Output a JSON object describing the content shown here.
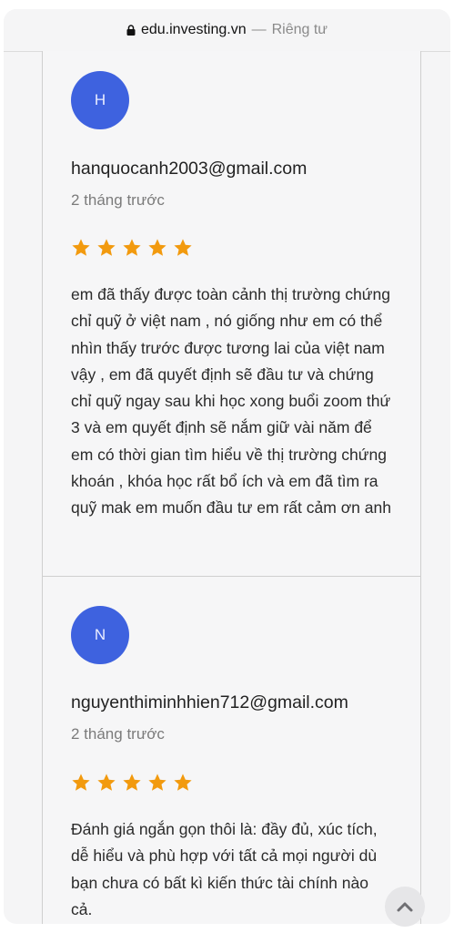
{
  "browser": {
    "domain": "edu.investing.vn",
    "separator": "—",
    "privacy_label": "Riêng tư"
  },
  "colors": {
    "avatar": "#3e62df",
    "star": "#f29a0e"
  },
  "reviews": [
    {
      "avatar_letter": "H",
      "email": "hanquocanh2003@gmail.com",
      "time": "2 tháng trước",
      "rating": 5,
      "text": "em đã thấy được toàn cảnh thị trường chứng chỉ quỹ ở việt nam , nó giống như em có thể nhìn thấy trước được tương lai của việt nam vậy , em đã quyết định sẽ đầu tư và chứng chỉ quỹ ngay sau khi học xong buổi zoom thứ 3 và em quyết định sẽ nắm giữ vài năm để em có thời gian tìm hiểu về thị trường chứng khoán , khóa học rất bổ ích và em đã tìm ra quỹ mak em muốn đầu tư em rất cảm ơn anh"
    },
    {
      "avatar_letter": "N",
      "email": "nguyenthiminhhien712@gmail.com",
      "time": "2 tháng trước",
      "rating": 5,
      "text": "Đánh giá ngắn gọn thôi là: đầy đủ, xúc tích, dễ hiểu và phù hợp với tất cả mọi người dù bạn chưa có bất kì kiến thức tài chính nào cả."
    }
  ]
}
